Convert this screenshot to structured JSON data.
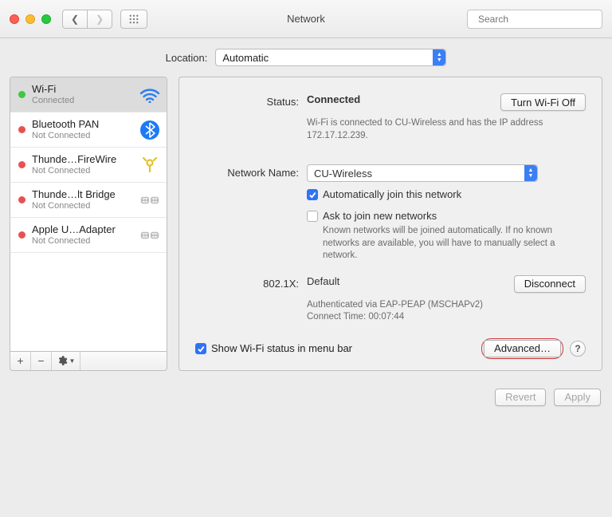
{
  "window": {
    "title": "Network",
    "search_placeholder": "Search"
  },
  "location": {
    "label": "Location:",
    "value": "Automatic"
  },
  "sidebar": {
    "items": [
      {
        "name": "Wi-Fi",
        "sub": "Connected",
        "status": "up",
        "icon": "wifi"
      },
      {
        "name": "Bluetooth PAN",
        "sub": "Not Connected",
        "status": "down",
        "icon": "bluetooth"
      },
      {
        "name": "Thunde…FireWire",
        "sub": "Not Connected",
        "status": "down",
        "icon": "firewire"
      },
      {
        "name": "Thunde…lt Bridge",
        "sub": "Not Connected",
        "status": "down",
        "icon": "bridge"
      },
      {
        "name": "Apple U…Adapter",
        "sub": "Not Connected",
        "status": "down",
        "icon": "bridge"
      }
    ]
  },
  "detail": {
    "status_label": "Status:",
    "status_value": "Connected",
    "turn_off_label": "Turn Wi-Fi Off",
    "status_desc": "Wi-Fi is connected to CU-Wireless and has the IP address 172.17.12.239.",
    "network_label": "Network Name:",
    "network_value": "CU-Wireless",
    "auto_join": "Automatically join this network",
    "ask_join": "Ask to join new networks",
    "ask_desc": "Known networks will be joined automatically. If no known networks are available, you will have to manually select a network.",
    "dot1x_label": "802.1X:",
    "dot1x_value": "Default",
    "disconnect_label": "Disconnect",
    "dot1x_desc1": "Authenticated via EAP-PEAP (MSCHAPv2)",
    "dot1x_desc2": "Connect Time: 00:07:44",
    "menubar_label": "Show Wi-Fi status in menu bar",
    "advanced_label": "Advanced…"
  },
  "footer": {
    "revert": "Revert",
    "apply": "Apply"
  }
}
